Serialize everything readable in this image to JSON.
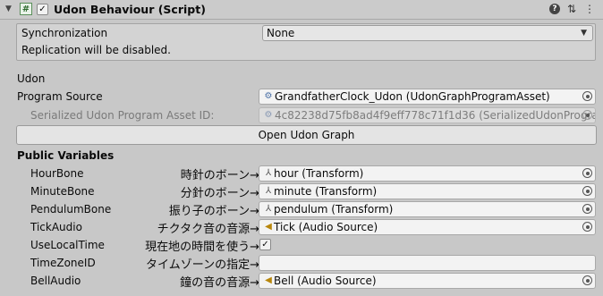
{
  "header": {
    "title": "Udon Behaviour (Script)",
    "script_icon_glyph": "#",
    "enabled_check": "✓"
  },
  "sync": {
    "label": "Synchronization",
    "value": "None",
    "note": "Replication will be disabled."
  },
  "udon": {
    "section_label": "Udon",
    "program_source_label": "Program Source",
    "program_source_value": "GrandfatherClock_Udon (UdonGraphProgramAsset)",
    "serialized_label": "Serialized Udon Program Asset ID:",
    "serialized_value": "4c82238d75fb8ad4f9eff778c71f1d36 (SerializedUdonProgram",
    "open_graph_label": "Open Udon Graph"
  },
  "public_variables": {
    "section_label": "Public Variables",
    "rows": [
      {
        "label": "HourBone",
        "annotation": "時針のボーン→",
        "value": "hour (Transform)",
        "icon": "transform-icon"
      },
      {
        "label": "MinuteBone",
        "annotation": "分針のボーン→",
        "value": "minute (Transform)",
        "icon": "transform-icon"
      },
      {
        "label": "PendulumBone",
        "annotation": "振り子のボーン→",
        "value": "pendulum (Transform)",
        "icon": "transform-icon"
      },
      {
        "label": "TickAudio",
        "annotation": "チクタク音の音源→",
        "value": "Tick (Audio Source)",
        "icon": "audio-source-icon"
      },
      {
        "label": "UseLocalTime",
        "annotation": "現在地の時間を使う→",
        "checked": "✓"
      },
      {
        "label": "TimeZoneID",
        "annotation": "タイムゾーンの指定→",
        "value": ""
      },
      {
        "label": "BellAudio",
        "annotation": "鐘の音の音源→",
        "value": "Bell (Audio Source)",
        "icon": "audio-source-icon"
      }
    ]
  },
  "colors": {
    "background": "#c8c8c8",
    "field": "#f3f3f3",
    "audio_icon": "#b8860b"
  }
}
